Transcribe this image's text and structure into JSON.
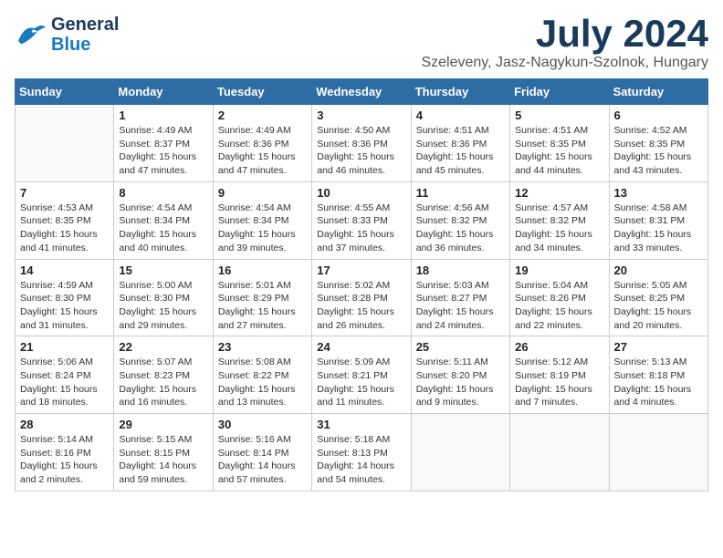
{
  "header": {
    "logo_line1": "General",
    "logo_line2": "Blue",
    "month": "July 2024",
    "location": "Szeleveny, Jasz-Nagykun-Szolnok, Hungary"
  },
  "weekdays": [
    "Sunday",
    "Monday",
    "Tuesday",
    "Wednesday",
    "Thursday",
    "Friday",
    "Saturday"
  ],
  "weeks": [
    [
      {
        "day": "",
        "info": ""
      },
      {
        "day": "1",
        "info": "Sunrise: 4:49 AM\nSunset: 8:37 PM\nDaylight: 15 hours\nand 47 minutes."
      },
      {
        "day": "2",
        "info": "Sunrise: 4:49 AM\nSunset: 8:36 PM\nDaylight: 15 hours\nand 47 minutes."
      },
      {
        "day": "3",
        "info": "Sunrise: 4:50 AM\nSunset: 8:36 PM\nDaylight: 15 hours\nand 46 minutes."
      },
      {
        "day": "4",
        "info": "Sunrise: 4:51 AM\nSunset: 8:36 PM\nDaylight: 15 hours\nand 45 minutes."
      },
      {
        "day": "5",
        "info": "Sunrise: 4:51 AM\nSunset: 8:35 PM\nDaylight: 15 hours\nand 44 minutes."
      },
      {
        "day": "6",
        "info": "Sunrise: 4:52 AM\nSunset: 8:35 PM\nDaylight: 15 hours\nand 43 minutes."
      }
    ],
    [
      {
        "day": "7",
        "info": "Sunrise: 4:53 AM\nSunset: 8:35 PM\nDaylight: 15 hours\nand 41 minutes."
      },
      {
        "day": "8",
        "info": "Sunrise: 4:54 AM\nSunset: 8:34 PM\nDaylight: 15 hours\nand 40 minutes."
      },
      {
        "day": "9",
        "info": "Sunrise: 4:54 AM\nSunset: 8:34 PM\nDaylight: 15 hours\nand 39 minutes."
      },
      {
        "day": "10",
        "info": "Sunrise: 4:55 AM\nSunset: 8:33 PM\nDaylight: 15 hours\nand 37 minutes."
      },
      {
        "day": "11",
        "info": "Sunrise: 4:56 AM\nSunset: 8:32 PM\nDaylight: 15 hours\nand 36 minutes."
      },
      {
        "day": "12",
        "info": "Sunrise: 4:57 AM\nSunset: 8:32 PM\nDaylight: 15 hours\nand 34 minutes."
      },
      {
        "day": "13",
        "info": "Sunrise: 4:58 AM\nSunset: 8:31 PM\nDaylight: 15 hours\nand 33 minutes."
      }
    ],
    [
      {
        "day": "14",
        "info": "Sunrise: 4:59 AM\nSunset: 8:30 PM\nDaylight: 15 hours\nand 31 minutes."
      },
      {
        "day": "15",
        "info": "Sunrise: 5:00 AM\nSunset: 8:30 PM\nDaylight: 15 hours\nand 29 minutes."
      },
      {
        "day": "16",
        "info": "Sunrise: 5:01 AM\nSunset: 8:29 PM\nDaylight: 15 hours\nand 27 minutes."
      },
      {
        "day": "17",
        "info": "Sunrise: 5:02 AM\nSunset: 8:28 PM\nDaylight: 15 hours\nand 26 minutes."
      },
      {
        "day": "18",
        "info": "Sunrise: 5:03 AM\nSunset: 8:27 PM\nDaylight: 15 hours\nand 24 minutes."
      },
      {
        "day": "19",
        "info": "Sunrise: 5:04 AM\nSunset: 8:26 PM\nDaylight: 15 hours\nand 22 minutes."
      },
      {
        "day": "20",
        "info": "Sunrise: 5:05 AM\nSunset: 8:25 PM\nDaylight: 15 hours\nand 20 minutes."
      }
    ],
    [
      {
        "day": "21",
        "info": "Sunrise: 5:06 AM\nSunset: 8:24 PM\nDaylight: 15 hours\nand 18 minutes."
      },
      {
        "day": "22",
        "info": "Sunrise: 5:07 AM\nSunset: 8:23 PM\nDaylight: 15 hours\nand 16 minutes."
      },
      {
        "day": "23",
        "info": "Sunrise: 5:08 AM\nSunset: 8:22 PM\nDaylight: 15 hours\nand 13 minutes."
      },
      {
        "day": "24",
        "info": "Sunrise: 5:09 AM\nSunset: 8:21 PM\nDaylight: 15 hours\nand 11 minutes."
      },
      {
        "day": "25",
        "info": "Sunrise: 5:11 AM\nSunset: 8:20 PM\nDaylight: 15 hours\nand 9 minutes."
      },
      {
        "day": "26",
        "info": "Sunrise: 5:12 AM\nSunset: 8:19 PM\nDaylight: 15 hours\nand 7 minutes."
      },
      {
        "day": "27",
        "info": "Sunrise: 5:13 AM\nSunset: 8:18 PM\nDaylight: 15 hours\nand 4 minutes."
      }
    ],
    [
      {
        "day": "28",
        "info": "Sunrise: 5:14 AM\nSunset: 8:16 PM\nDaylight: 15 hours\nand 2 minutes."
      },
      {
        "day": "29",
        "info": "Sunrise: 5:15 AM\nSunset: 8:15 PM\nDaylight: 14 hours\nand 59 minutes."
      },
      {
        "day": "30",
        "info": "Sunrise: 5:16 AM\nSunset: 8:14 PM\nDaylight: 14 hours\nand 57 minutes."
      },
      {
        "day": "31",
        "info": "Sunrise: 5:18 AM\nSunset: 8:13 PM\nDaylight: 14 hours\nand 54 minutes."
      },
      {
        "day": "",
        "info": ""
      },
      {
        "day": "",
        "info": ""
      },
      {
        "day": "",
        "info": ""
      }
    ]
  ]
}
